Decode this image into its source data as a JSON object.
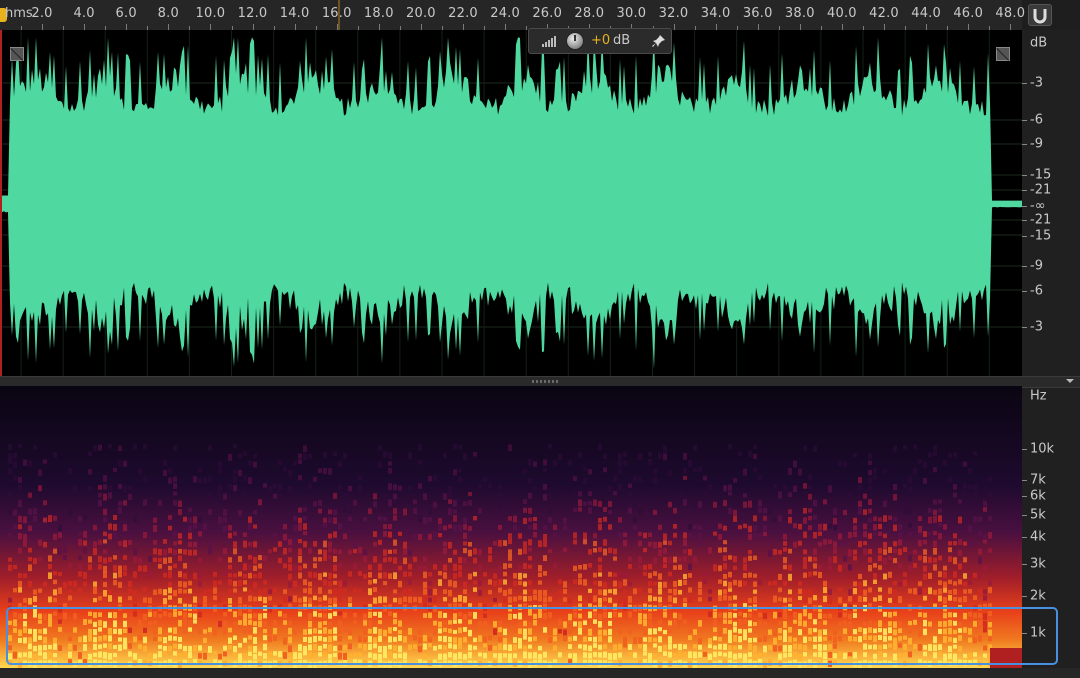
{
  "ruler": {
    "unit_label": "hms",
    "ticks": [
      "2.0",
      "4.0",
      "6.0",
      "8.0",
      "10.0",
      "12.0",
      "14.0",
      "16.0",
      "18.0",
      "20.0",
      "22.0",
      "24.0",
      "26.0",
      "28.0",
      "30.0",
      "32.0",
      "34.0",
      "36.0",
      "38.0",
      "40.0",
      "42.0",
      "44.0",
      "46.0",
      "48.0"
    ],
    "snap_icon": "magnet-icon"
  },
  "hud": {
    "meter_icon": "level-meter-icon",
    "knob_icon": "volume-knob-icon",
    "value": "+0",
    "unit": "dB",
    "pin_icon": "pin-icon"
  },
  "waveform": {
    "color": "#4fd8a0",
    "background": "#000000",
    "db_scale": {
      "unit": "dB",
      "labels": [
        "-3",
        "-6",
        "-9",
        "-15",
        "-21",
        "-∞",
        "-21",
        "-15",
        "-9",
        "-6",
        "-3"
      ]
    }
  },
  "spectral": {
    "freq_scale": {
      "unit": "Hz",
      "labels": [
        "10k",
        "7k",
        "6k",
        "5k",
        "4k",
        "3k",
        "2k",
        "1k"
      ]
    },
    "colors": {
      "low": "#12081e",
      "mid": "#8a1a3a",
      "high": "#e8321e",
      "peak": "#ffe860"
    }
  },
  "selection": {
    "color": "#4a90e0"
  }
}
